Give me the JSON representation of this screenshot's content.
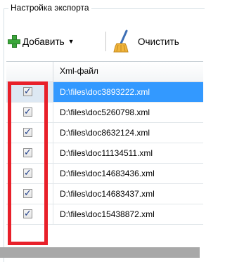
{
  "group": {
    "title": "Настройка экспорта"
  },
  "toolbar": {
    "add_label": "Добавить",
    "add_icon": "plus-icon",
    "clear_label": "Очистить",
    "clear_icon": "broom-icon"
  },
  "grid": {
    "column_header": "Xml-файл",
    "rows": [
      {
        "checked": true,
        "file": "D:\\files\\doc3893222.xml",
        "selected": true
      },
      {
        "checked": true,
        "file": "D:\\files\\doc5260798.xml",
        "selected": false
      },
      {
        "checked": true,
        "file": "D:\\files\\doc8632124.xml",
        "selected": false
      },
      {
        "checked": true,
        "file": "D:\\files\\doc11134511.xml",
        "selected": false
      },
      {
        "checked": true,
        "file": "D:\\files\\doc14683436.xml",
        "selected": false
      },
      {
        "checked": true,
        "file": "D:\\files\\doc14683437.xml",
        "selected": false
      },
      {
        "checked": true,
        "file": "D:\\files\\doc15438872.xml",
        "selected": false
      }
    ]
  },
  "colors": {
    "selection": "#3399ff",
    "highlight_border": "#e8202a",
    "add_icon": "#3aa63a"
  }
}
